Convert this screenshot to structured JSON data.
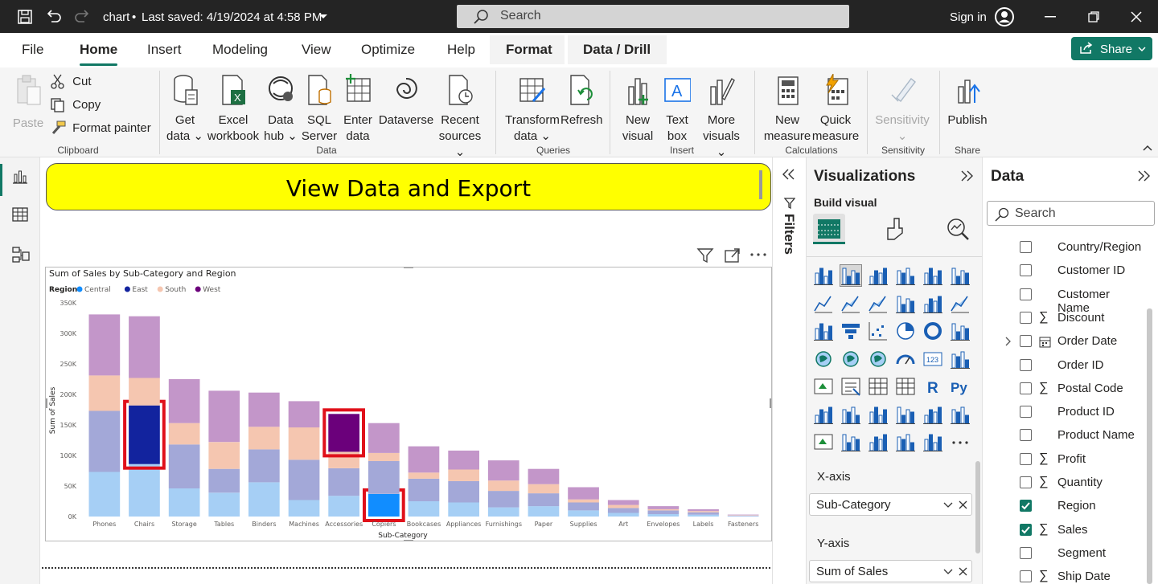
{
  "title_bar": {
    "doc_title": "chart",
    "saved_status": "Last saved: 4/19/2024 at 4:58 PM",
    "search_placeholder": "Search",
    "sign_in": "Sign in"
  },
  "menu": {
    "items": [
      "File",
      "Home",
      "Insert",
      "Modeling",
      "View",
      "Optimize",
      "Help",
      "Format",
      "Data / Drill"
    ],
    "active": "Home",
    "share_label": "Share"
  },
  "ribbon": {
    "clipboard": {
      "paste": "Paste",
      "cut": "Cut",
      "copy": "Copy",
      "format_painter": "Format painter",
      "group": "Clipboard"
    },
    "data": {
      "get_data_1": "Get",
      "get_data_2": "data",
      "excel_1": "Excel",
      "excel_2": "workbook",
      "hub_1": "Data",
      "hub_2": "hub",
      "sql_1": "SQL",
      "sql_2": "Server",
      "enter_1": "Enter",
      "enter_2": "data",
      "dataverse": "Dataverse",
      "recent_1": "Recent",
      "recent_2": "sources",
      "group": "Data"
    },
    "queries": {
      "transform_1": "Transform",
      "transform_2": "data",
      "refresh": "Refresh",
      "group": "Queries"
    },
    "insert": {
      "new_visual_1": "New",
      "new_visual_2": "visual",
      "text_box_1": "Text",
      "text_box_2": "box",
      "more_1": "More",
      "more_2": "visuals",
      "group": "Insert"
    },
    "calculations": {
      "new_measure_1": "New",
      "new_measure_2": "measure",
      "quick_measure_1": "Quick",
      "quick_measure_2": "measure",
      "group": "Calculations"
    },
    "sensitivity": {
      "label": "Sensitivity",
      "group": "Sensitivity"
    },
    "share": {
      "publish": "Publish",
      "group": "Share"
    }
  },
  "canvas": {
    "banner_text": "View Data and Export"
  },
  "chart_data": {
    "type": "bar",
    "title": "Sum of Sales by Sub-Category and Region",
    "legend_title": "Region",
    "xlabel": "Sub-Category",
    "ylabel": "Sum of Sales",
    "y_ticks": [
      "0K",
      "50K",
      "100K",
      "150K",
      "200K",
      "250K",
      "300K",
      "350K"
    ],
    "ylim": [
      0,
      350000
    ],
    "categories": [
      "Phones",
      "Chairs",
      "Storage",
      "Tables",
      "Binders",
      "Machines",
      "Accessories",
      "Copiers",
      "Bookcases",
      "Appliances",
      "Furnishings",
      "Paper",
      "Supplies",
      "Art",
      "Envelopes",
      "Labels",
      "Fasteners"
    ],
    "series": [
      {
        "name": "Central",
        "color": "#a6cff5",
        "values": [
          73000,
          86000,
          46000,
          39000,
          56000,
          27000,
          34000,
          37000,
          25000,
          23000,
          15000,
          17000,
          10000,
          6000,
          4000,
          3000,
          800
        ]
      },
      {
        "name": "East",
        "color": "#a3a8d8",
        "values": [
          100000,
          96000,
          72000,
          39000,
          54000,
          66000,
          45000,
          54000,
          37000,
          35000,
          27000,
          21000,
          13000,
          8000,
          6000,
          4000,
          900
        ]
      },
      {
        "name": "South",
        "color": "#f5c6b0",
        "values": [
          58000,
          45000,
          35000,
          44000,
          37000,
          53000,
          27000,
          13000,
          10000,
          19000,
          17000,
          15000,
          5000,
          5000,
          2000,
          2000,
          600
        ]
      },
      {
        "name": "West",
        "color": "#c396c9",
        "values": [
          100000,
          101000,
          72000,
          84000,
          56000,
          43000,
          62000,
          49000,
          43000,
          31000,
          33000,
          25000,
          20000,
          8000,
          5000,
          3000,
          800
        ]
      }
    ],
    "highlight_colors": {
      "Central": "#118dff",
      "East": "#12239e",
      "West": "#6b007b"
    },
    "highlights": [
      {
        "category": "Chairs",
        "series": "East"
      },
      {
        "category": "Accessories",
        "series": "West"
      },
      {
        "category": "Copiers",
        "series": "Central"
      }
    ]
  },
  "filters": {
    "label": "Filters"
  },
  "visualizations": {
    "title": "Visualizations",
    "build_visual": "Build visual",
    "x_axis_label": "X-axis",
    "x_axis_field": "Sub-Category",
    "y_axis_label": "Y-axis",
    "y_axis_field": "Sum of Sales"
  },
  "data_pane": {
    "title": "Data",
    "search_placeholder": "Search",
    "fields": [
      {
        "name": "Country/Region",
        "sigma": false,
        "checked": false
      },
      {
        "name": "Customer ID",
        "sigma": false,
        "checked": false
      },
      {
        "name": "Customer Name",
        "sigma": false,
        "checked": false
      },
      {
        "name": "Discount",
        "sigma": true,
        "checked": false
      },
      {
        "name": "Order Date",
        "sigma": false,
        "calendar": true,
        "checked": false
      },
      {
        "name": "Order ID",
        "sigma": false,
        "checked": false
      },
      {
        "name": "Postal Code",
        "sigma": true,
        "checked": false
      },
      {
        "name": "Product ID",
        "sigma": false,
        "checked": false
      },
      {
        "name": "Product Name",
        "sigma": false,
        "checked": false
      },
      {
        "name": "Profit",
        "sigma": true,
        "checked": false
      },
      {
        "name": "Quantity",
        "sigma": true,
        "checked": false
      },
      {
        "name": "Region",
        "sigma": false,
        "checked": true
      },
      {
        "name": "Sales",
        "sigma": true,
        "checked": true
      },
      {
        "name": "Segment",
        "sigma": false,
        "checked": false
      },
      {
        "name": "Ship Date",
        "sigma": true,
        "checked": false
      }
    ]
  }
}
